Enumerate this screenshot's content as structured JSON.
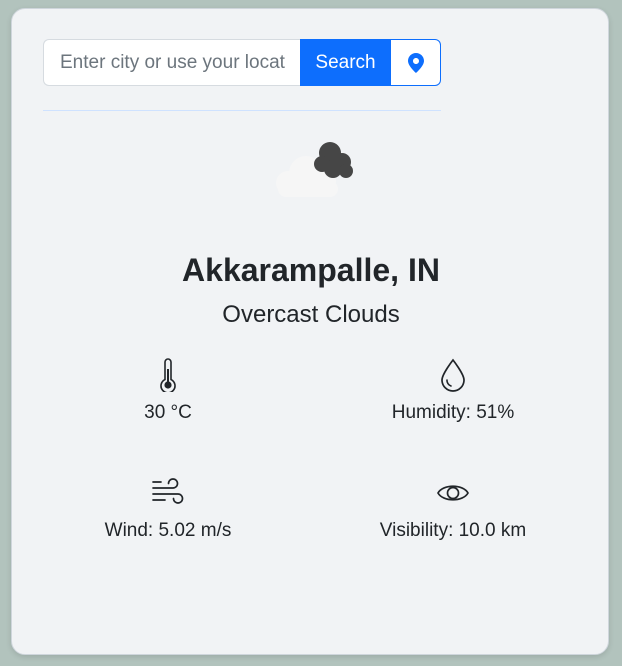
{
  "search": {
    "placeholder": "Enter city or use your location",
    "button_label": "Search"
  },
  "weather": {
    "city": "Akkarampalle, IN",
    "description": "Overcast Clouds",
    "icon": "overcast-clouds-icon"
  },
  "stats": {
    "temperature": "30 °C",
    "humidity": "Humidity: 51%",
    "wind": "Wind: 5.02 m/s",
    "visibility": "Visibility: 10.0 km"
  },
  "colors": {
    "accent": "#0d6efd",
    "card_background": "#f1f3f5",
    "page_background": "#b2c3bd"
  }
}
